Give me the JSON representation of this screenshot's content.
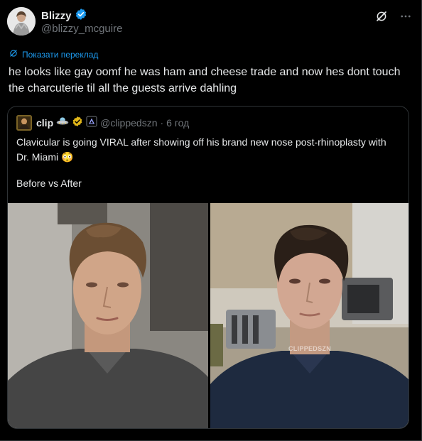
{
  "author": {
    "display_name": "Blizzy",
    "handle": "@blizzy_mcguire",
    "verified": true
  },
  "translate_link": "Показати переклад",
  "tweet_text": "he looks like gay oomf he was ham and cheese trade and now hes dont touch the charcuterie til all the guests arrive dahling",
  "quote": {
    "display_name": "clip",
    "handle": "@clippedszn",
    "time_sep": "·",
    "time": "6 год",
    "text_line1": "Clavicular is going VIRAL after showing off his brand new nose post-rhinoplasty with Dr. Miami 😳",
    "text_line2": "Before vs After",
    "watermark": "CLIPPEDSZN"
  },
  "icons": {
    "verified": "verified-badge-icon",
    "grok": "grok-icon",
    "more": "more-icon",
    "translate": "translate-icon",
    "ufo": "ufo-emoji-icon",
    "gold_verified": "gold-verified-icon",
    "affiliate": "affiliate-badge-icon"
  },
  "colors": {
    "background": "#000000",
    "text": "#e7e9ea",
    "muted": "#71767b",
    "link": "#1d9bf0",
    "border": "#2f3336",
    "verified_blue": "#1d9bf0",
    "verified_gold": "#e2b719"
  }
}
